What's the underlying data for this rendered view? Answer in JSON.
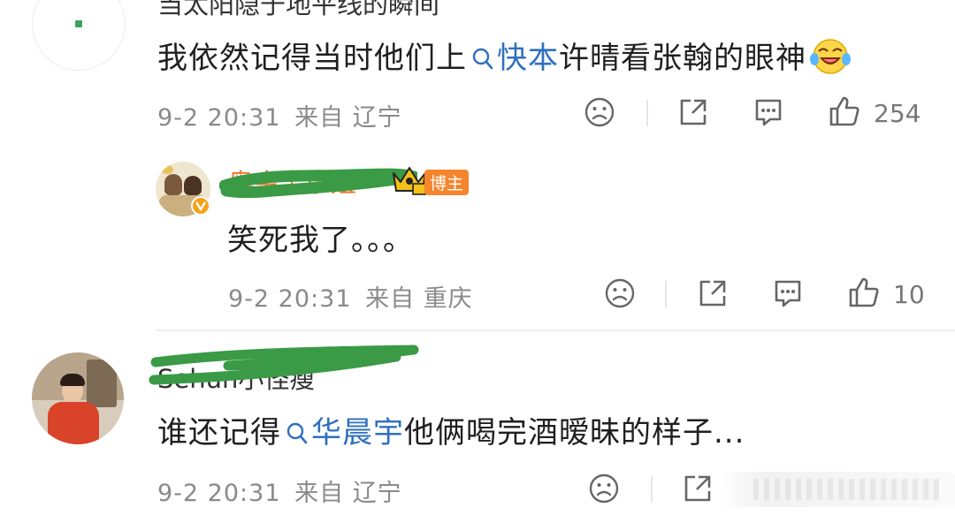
{
  "comments": [
    {
      "username": "当太阳隐于地平线的瞬间",
      "text_before": "我依然记得当时他们上",
      "topic": "快本",
      "text_after": "许晴看张翰的眼神",
      "time": "9-2 20:31",
      "from_prefix": "来自",
      "location": "辽宁",
      "like_count": "254"
    },
    {
      "username": "奥金卡小妞",
      "badge": "博主",
      "text": "笑死我了。。。",
      "time": "9-2 20:31",
      "from_prefix": "来自",
      "location": "重庆",
      "like_count": "10"
    },
    {
      "username": "Sehun小怪瘦",
      "text_before": "谁还记得",
      "topic": "华晨宇",
      "text_after": "他俩喝完酒暧昧的样子...",
      "time": "9-2 20:31",
      "from_prefix": "来自",
      "location": "辽宁"
    }
  ],
  "colors": {
    "topic_link": "#2f6fbf",
    "badge_bg": "#f6852d",
    "scribble": "#3a9a45",
    "meta_text": "#8a8a8a"
  },
  "icons": [
    "dislike-icon",
    "share-icon",
    "comment-icon",
    "like-icon",
    "laugh-cry-emoji",
    "search-icon",
    "crown-icon"
  ]
}
